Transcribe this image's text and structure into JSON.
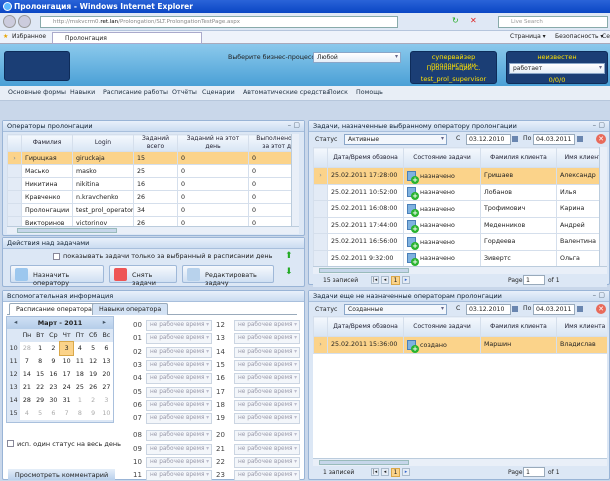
{
  "browser": {
    "title": "Пролонгация - Windows Internet Explorer",
    "url_prefix": "http://mskvcrm0.",
    "url_host": "ret.lan",
    "url_path": "/Prolongation/SLT.ProlongationTestPage.aspx",
    "search_placeholder": "Live Search",
    "favorites": "Избранное",
    "tab": "Пролонгация",
    "page_menu": "Страница ▾",
    "security_menu": "Безопасность ▾",
    "tools_menu": "Се"
  },
  "header": {
    "bp_label": "Выберите бизнес-процесс:",
    "bp_value": "Любой",
    "role": "супервайзер пролонгации",
    "user_name": "Пролонгации С.",
    "login": "test_prol_supervisor",
    "status_title": "неизвестен",
    "status_value": "работает",
    "counters": "0/0/0"
  },
  "menu": [
    "Основные формы",
    "Навыки",
    "Расписание работы",
    "Отчёты",
    "Сценарии",
    "Автоматические средства",
    "Поиск",
    "Помощь"
  ],
  "operators": {
    "title": "Операторы пролонгации",
    "columns": [
      "Фамилия",
      "Login",
      "Заданий всего",
      "Заданий на этот день",
      "Выполнено зад за этот ден"
    ],
    "rows": [
      [
        "Гирuцкая",
        "giruckaja",
        "15",
        "0",
        "0"
      ],
      [
        "Масько",
        "masko",
        "25",
        "0",
        "0"
      ],
      [
        "Никитина",
        "nikitina",
        "16",
        "0",
        "0"
      ],
      [
        "Кравченко",
        "n.kravchenko",
        "26",
        "0",
        "0"
      ],
      [
        "Пролонгации",
        "test_prol_operator",
        "34",
        "0",
        "0"
      ],
      [
        "Викторинов",
        "victorinov",
        "26",
        "0",
        "0"
      ]
    ]
  },
  "actions": {
    "title": "Действия над задачами",
    "checkbox": "показывать задачи только за выбранный в расписании день",
    "assign": "Назначить оператору",
    "remove": "Снять задачи",
    "edit": "Редактировать задачу"
  },
  "aux": {
    "title": "Вспомогательная информация",
    "tab1": "Расписание оператора",
    "tab2": "Навыки оператора",
    "month": "Март - 2011",
    "weekdays": [
      "Пн",
      "Вт",
      "Ср",
      "Чт",
      "Пт",
      "Сб",
      "Вс"
    ],
    "weeks": [
      [
        "10",
        "28",
        "1",
        "2",
        "3",
        "4",
        "5",
        "6"
      ],
      [
        "11",
        "7",
        "8",
        "9",
        "10",
        "11",
        "12",
        "13"
      ],
      [
        "12",
        "14",
        "15",
        "16",
        "17",
        "18",
        "19",
        "20"
      ],
      [
        "13",
        "21",
        "22",
        "23",
        "24",
        "25",
        "26",
        "27"
      ],
      [
        "14",
        "28",
        "29",
        "30",
        "31",
        "1",
        "2",
        "3"
      ],
      [
        "15",
        "4",
        "5",
        "6",
        "7",
        "8",
        "9",
        "10"
      ]
    ],
    "one_status": "исп. один статус на весь день",
    "view_comment": "Просмотреть комментарий",
    "hours": [
      "00",
      "01",
      "02",
      "03",
      "04",
      "05",
      "06",
      "07",
      "08",
      "09",
      "10",
      "11",
      "12",
      "13",
      "14",
      "15",
      "16",
      "17",
      "18",
      "19",
      "20",
      "21",
      "22",
      "23"
    ],
    "hour_value": "не рабочее время"
  },
  "assigned": {
    "title": "Задачи, назначенные выбранному оператору пролонгации",
    "status_label": "Статус",
    "status_value": "Активные",
    "from_label": "С",
    "from": "03.12.2010",
    "to_label": "По",
    "to": "04.03.2011",
    "columns": [
      "Дата/Время обзвона",
      "Состояние задачи",
      "Фамилия клиента",
      "Имя клиента"
    ],
    "rows": [
      [
        "25.02.2011 17:28:00",
        "назначено",
        "Гришаев",
        "Александр"
      ],
      [
        "25.02.2011 10:52:00",
        "назначено",
        "Лобанов",
        "Илья"
      ],
      [
        "25.02.2011 16:08:00",
        "назначено",
        "Трофимович",
        "Карина"
      ],
      [
        "25.02.2011 17:44:00",
        "назначено",
        "Меденников",
        "Андрей"
      ],
      [
        "25.02.2011 16:56:00",
        "назначено",
        "Гордеева",
        "Валентина"
      ],
      [
        "25.02.2011 9:32:00",
        "назначено",
        "Зивертс",
        "Ольга"
      ]
    ],
    "count": "15 записей",
    "page_label": "Page",
    "page": "1",
    "of": "of 1",
    "current_page": "1"
  },
  "unassigned": {
    "title": "Задачи еще не назначенные операторам пролонгации",
    "status_label": "Статус",
    "status_value": "Созданные",
    "from_label": "С",
    "from": "03.12.2010",
    "to_label": "По",
    "to": "04.03.2011",
    "columns": [
      "Дата/Время обзвона",
      "Состояние задачи",
      "Фамилия клиента",
      "Имя клиента"
    ],
    "rows": [
      [
        "25.02.2011 15:36:00",
        "создано",
        "Маршин",
        "Владислав"
      ]
    ],
    "count": "1 записей",
    "page_label": "Page",
    "page": "1",
    "of": "of 1",
    "current_page": "1"
  },
  "colors": {
    "accent": "#fbd38a",
    "header_dark": "#1b3e75",
    "yellow": "#ffe100"
  }
}
